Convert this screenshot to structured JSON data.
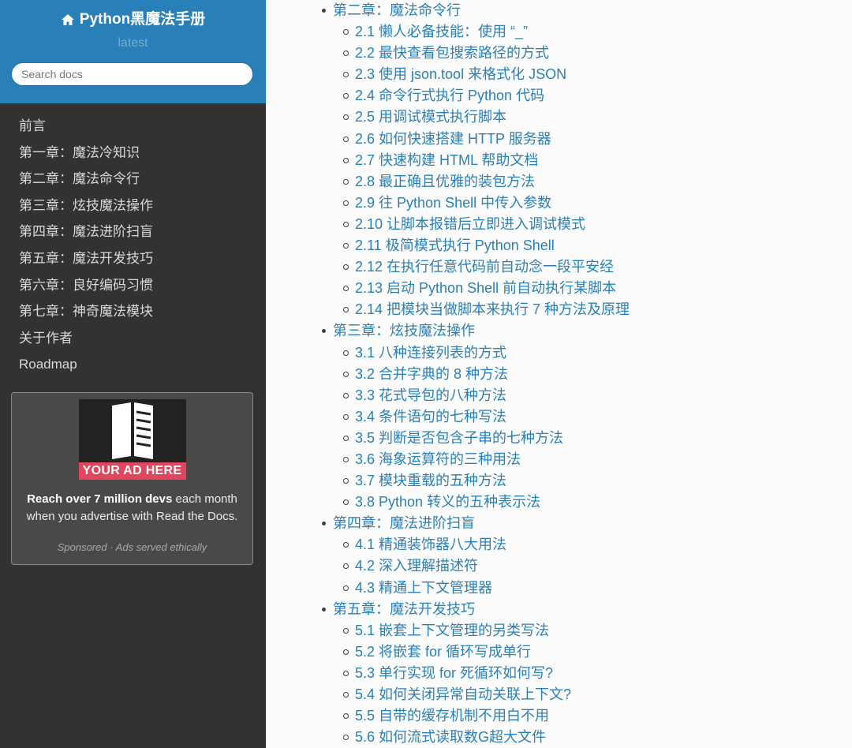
{
  "sidebar": {
    "brand": "Python黑魔法手册",
    "version": "latest",
    "search_placeholder": "Search docs",
    "nav": [
      "前言",
      "第一章：魔法冷知识",
      "第二章：魔法命令行",
      "第三章：炫技魔法操作",
      "第四章：魔法进阶扫盲",
      "第五章：魔法开发技巧",
      "第六章：良好编码习惯",
      "第七章：神奇魔法模块",
      "关于作者",
      "Roadmap"
    ],
    "ad": {
      "banner": "YOUR AD HERE",
      "text_bold": "Reach over 7 million devs",
      "text_rest": " each month when you advertise with Read the Docs.",
      "sponsored": "Sponsored · Ads served ethically"
    }
  },
  "toc": [
    {
      "title": "第二章：魔法命令行",
      "sections": [
        "2.1 懒人必备技能：使用 “_”",
        "2.2 最快查看包搜索路径的方式",
        "2.3 使用 json.tool 来格式化 JSON",
        "2.4 命令行式执行 Python 代码",
        "2.5 用调试模式执行脚本",
        "2.6 如何快速搭建 HTTP 服务器",
        "2.7 快速构建 HTML 帮助文档",
        "2.8 最正确且优雅的装包方法",
        "2.9 往 Python Shell 中传入参数",
        "2.10 让脚本报错后立即进入调试模式",
        "2.11 极简模式执行 Python Shell",
        "2.12 在执行任意代码前自动念一段平安经",
        "2.13 启动 Python Shell 前自动执行某脚本",
        "2.14 把模块当做脚本来执行 7 种方法及原理"
      ]
    },
    {
      "title": "第三章：炫技魔法操作",
      "sections": [
        "3.1 八种连接列表的方式",
        "3.2 合并字典的 8 种方法",
        "3.3 花式导包的八种方法",
        "3.4 条件语句的七种写法",
        "3.5 判断是否包含子串的七种方法",
        "3.6 海象运算符的三种用法",
        "3.7 模块重载的五种方法",
        "3.8 Python 转义的五种表示法"
      ]
    },
    {
      "title": "第四章：魔法进阶扫盲",
      "sections": [
        "4.1 精通装饰器八大用法",
        "4.2 深入理解描述符",
        "4.3 精通上下文管理器"
      ]
    },
    {
      "title": "第五章：魔法开发技巧",
      "sections": [
        "5.1 嵌套上下文管理的另类写法",
        "5.2 将嵌套 for 循环写成单行",
        "5.3 单行实现 for 死循环如何写?",
        "5.4 如何关闭异常自动关联上下文?",
        "5.5 自带的缓存机制不用白不用",
        "5.6 如何流式读取数G超大文件"
      ]
    }
  ]
}
